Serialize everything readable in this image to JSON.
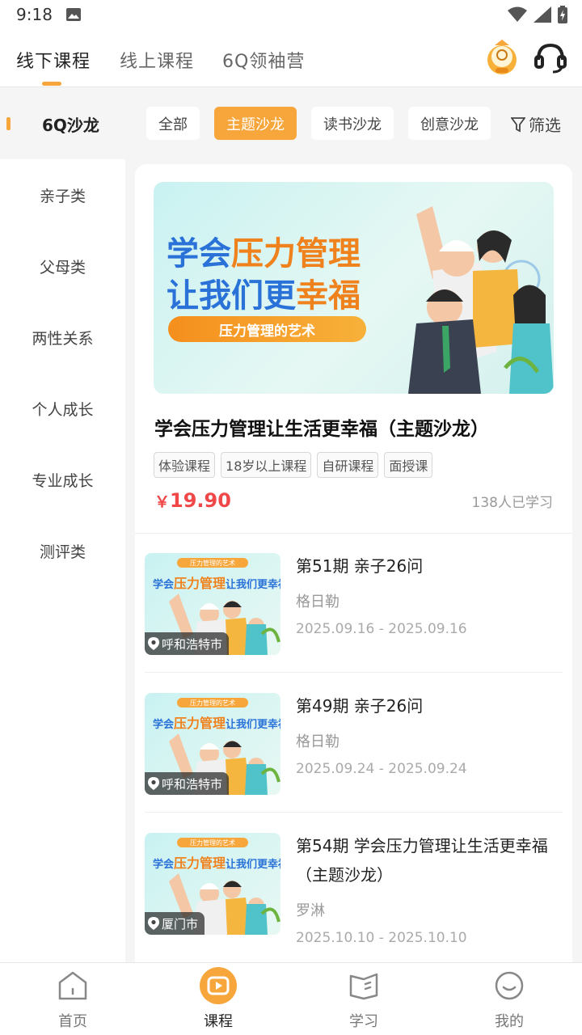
{
  "status_bar": {
    "time": "9:18"
  },
  "top_tabs": [
    {
      "label": "线下课程",
      "active": true
    },
    {
      "label": "线上课程",
      "active": false
    },
    {
      "label": "6Q领袖营",
      "active": false
    }
  ],
  "filter": {
    "category_title": "6Q沙龙",
    "chips": [
      {
        "label": "全部",
        "active": false
      },
      {
        "label": "主题沙龙",
        "active": true
      },
      {
        "label": "读书沙龙",
        "active": false
      },
      {
        "label": "创意沙龙",
        "active": false
      }
    ],
    "filter_label": "筛选"
  },
  "side_categories": [
    "亲子类",
    "父母类",
    "两性关系",
    "个人成长",
    "专业成长",
    "测评类"
  ],
  "featured": {
    "banner": {
      "line1_prefix": "学会",
      "line1_highlight": "压力管理",
      "line2_prefix": "让我们更",
      "line2_highlight": "幸福",
      "pill": "压力管理的艺术"
    },
    "title": "学会压力管理让生活更幸福（主题沙龙）",
    "tags": [
      "体验课程",
      "18岁以上课程",
      "自研课程",
      "面授课"
    ],
    "currency": "￥",
    "price": "19.90",
    "learners": "138人已学习"
  },
  "thumb_text": {
    "pill": "压力管理的艺术",
    "prefix": "学会",
    "highlight": "压力管理",
    "suffix": "让我们更幸福"
  },
  "sessions": [
    {
      "title": "第51期  亲子26问",
      "teacher": "格日勒",
      "date": "2025.09.16 - 2025.09.16",
      "location": "呼和浩特市"
    },
    {
      "title": "第49期  亲子26问",
      "teacher": "格日勒",
      "date": "2025.09.24 - 2025.09.24",
      "location": "呼和浩特市"
    },
    {
      "title": "第54期  学会压力管理让生活更幸福（主题沙龙）",
      "teacher": "罗淋",
      "date": "2025.10.10 - 2025.10.10",
      "location": "厦门市"
    }
  ],
  "bottom_nav": [
    {
      "label": "首页",
      "icon": "home-icon",
      "active": false
    },
    {
      "label": "课程",
      "icon": "course-play-icon",
      "active": true
    },
    {
      "label": "学习",
      "icon": "book-icon",
      "active": false
    },
    {
      "label": "我的",
      "icon": "profile-icon",
      "active": false
    }
  ],
  "colors": {
    "accent": "#f7a63c",
    "price": "#f04848",
    "banner_blue": "#2a72d8"
  }
}
